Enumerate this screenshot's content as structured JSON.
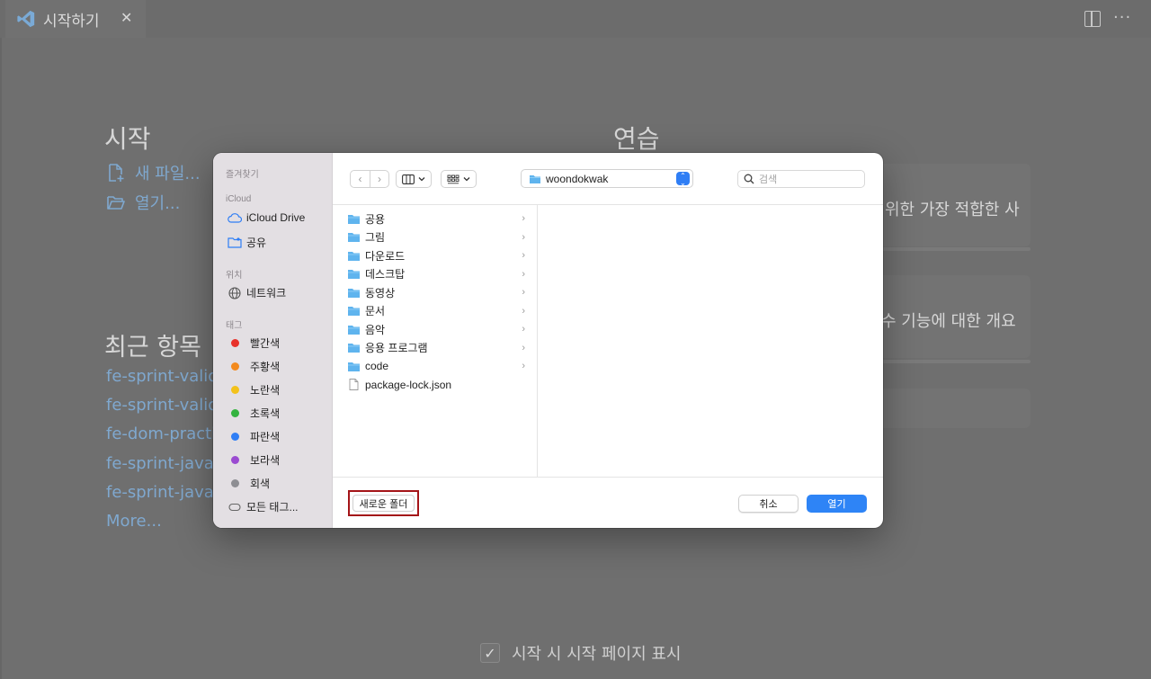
{
  "editor": {
    "tab_title": "시작하기",
    "close_glyph": "✕",
    "more_glyph": "···",
    "start_heading": "시작",
    "new_file": "새 파일...",
    "open": "열기...",
    "practice_heading": "연습",
    "walkthrough_1": "위한 가장 적합한 사",
    "walkthrough_2": "수 기능에 대한 개요",
    "recent_heading": "최근 항목",
    "recent": [
      "fe-sprint-valida",
      "fe-sprint-valida",
      "fe-dom-practic",
      "fe-sprint-javas",
      "fe-sprint-javas"
    ],
    "more": "More...",
    "show_on_startup": "시작 시 시작 페이지 표시",
    "check_glyph": "✓"
  },
  "dialog": {
    "sidebar": {
      "favorites": "즐겨찾기",
      "icloud": "iCloud",
      "icloud_drive": "iCloud Drive",
      "shared": "공유",
      "locations": "위치",
      "network": "네트워크",
      "tags": "태그",
      "tag_items": [
        {
          "label": "빨간색",
          "color": "#e8312a"
        },
        {
          "label": "주황색",
          "color": "#f38a1e"
        },
        {
          "label": "노란색",
          "color": "#f3c21b"
        },
        {
          "label": "초록색",
          "color": "#34b33f"
        },
        {
          "label": "파란색",
          "color": "#2f7ef5"
        },
        {
          "label": "보라색",
          "color": "#9b4bd1"
        },
        {
          "label": "회색",
          "color": "#8e8e93"
        }
      ],
      "all_tags": "모든 태그..."
    },
    "toolbar": {
      "back_glyph": "‹",
      "forward_glyph": "›",
      "location": "woondokwak",
      "search_placeholder": "검색"
    },
    "files": [
      {
        "name": "공용",
        "type": "folder"
      },
      {
        "name": "그림",
        "type": "folder"
      },
      {
        "name": "다운로드",
        "type": "folder"
      },
      {
        "name": "데스크탑",
        "type": "folder"
      },
      {
        "name": "동영상",
        "type": "folder"
      },
      {
        "name": "문서",
        "type": "folder"
      },
      {
        "name": "음악",
        "type": "folder"
      },
      {
        "name": "응용 프로그램",
        "type": "folder"
      },
      {
        "name": "code",
        "type": "folder"
      },
      {
        "name": "package-lock.json",
        "type": "file"
      }
    ],
    "footer": {
      "new_folder": "새로운 폴더",
      "cancel": "취소",
      "open": "열기"
    },
    "colors": {
      "accent": "#2e84f6",
      "highlight": "#a41418",
      "folder": "#5fb4ee"
    }
  }
}
